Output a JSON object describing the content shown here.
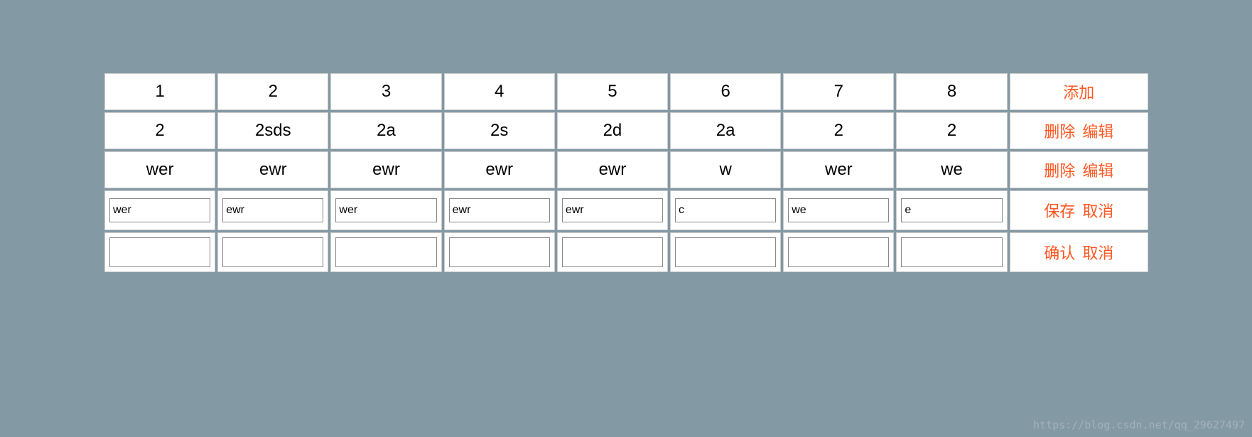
{
  "table": {
    "headers": [
      "1",
      "2",
      "3",
      "4",
      "5",
      "6",
      "7",
      "8"
    ],
    "headerAction": "添加",
    "rows": [
      {
        "cells": [
          "2",
          "2sds",
          "2a",
          "2s",
          "2d",
          "2a",
          "2",
          "2"
        ],
        "actions": [
          "删除",
          "编辑"
        ]
      },
      {
        "cells": [
          "wer",
          "ewr",
          "ewr",
          "ewr",
          "ewr",
          "w",
          "wer",
          "we"
        ],
        "actions": [
          "删除",
          "编辑"
        ]
      }
    ],
    "editRow": {
      "values": [
        "wer",
        "ewr",
        "wer",
        "ewr",
        "ewr",
        "c",
        "we",
        "e"
      ],
      "actions": [
        "保存",
        "取消"
      ]
    },
    "newRow": {
      "values": [
        "",
        "",
        "",
        "",
        "",
        "",
        "",
        ""
      ],
      "actions": [
        "确认",
        "取消"
      ]
    }
  },
  "watermark": "https://blog.csdn.net/qq_29627497"
}
